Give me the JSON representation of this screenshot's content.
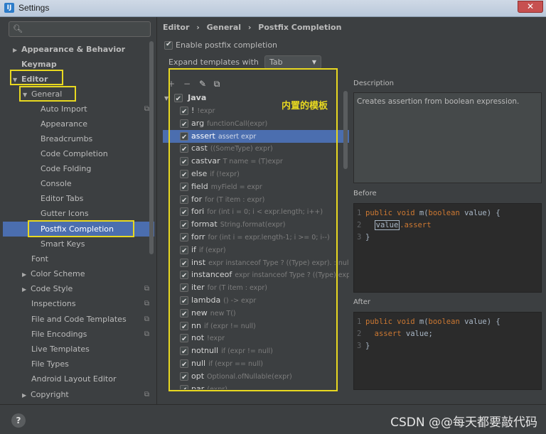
{
  "window": {
    "title": "Settings",
    "close": "✕"
  },
  "search": {
    "placeholder": "Q‣"
  },
  "sidebar": {
    "items": [
      {
        "label": "Appearance & Behavior"
      },
      {
        "label": "Keymap"
      },
      {
        "label": "Editor"
      },
      {
        "label": "General"
      },
      {
        "label": "Auto Import"
      },
      {
        "label": "Appearance"
      },
      {
        "label": "Breadcrumbs"
      },
      {
        "label": "Code Completion"
      },
      {
        "label": "Code Folding"
      },
      {
        "label": "Console"
      },
      {
        "label": "Editor Tabs"
      },
      {
        "label": "Gutter Icons"
      },
      {
        "label": "Postfix Completion"
      },
      {
        "label": "Smart Keys"
      },
      {
        "label": "Font"
      },
      {
        "label": "Color Scheme"
      },
      {
        "label": "Code Style"
      },
      {
        "label": "Inspections"
      },
      {
        "label": "File and Code Templates"
      },
      {
        "label": "File Encodings"
      },
      {
        "label": "Live Templates"
      },
      {
        "label": "File Types"
      },
      {
        "label": "Android Layout Editor"
      },
      {
        "label": "Copyright"
      }
    ]
  },
  "breadcrumb": {
    "a": "Editor",
    "sep": "›",
    "b": "General",
    "c": "Postfix Completion"
  },
  "options": {
    "enable_label": "Enable postfix completion",
    "expand_label": "Expand templates with",
    "expand_value": "Tab"
  },
  "annotation": "内置的模板",
  "templates": {
    "group": "Java",
    "rows": [
      {
        "key": "!",
        "expr": "!expr"
      },
      {
        "key": "arg",
        "expr": "functionCall(expr)"
      },
      {
        "key": "assert",
        "expr": "assert expr"
      },
      {
        "key": "cast",
        "expr": "((SomeType) expr)"
      },
      {
        "key": "castvar",
        "expr": "T name = (T)expr"
      },
      {
        "key": "else",
        "expr": "if (!expr)"
      },
      {
        "key": "field",
        "expr": "myField = expr"
      },
      {
        "key": "for",
        "expr": "for (T item : expr)"
      },
      {
        "key": "fori",
        "expr": "for (int i = 0; i < expr.length; i++)"
      },
      {
        "key": "format",
        "expr": "String.format(expr)"
      },
      {
        "key": "forr",
        "expr": "for (int i = expr.length-1; i >= 0; i--)"
      },
      {
        "key": "if",
        "expr": "if (expr)"
      },
      {
        "key": "inst",
        "expr": "expr instanceof Type ? ((Type) expr). : null"
      },
      {
        "key": "instanceof",
        "expr": "expr instanceof Type ? ((Type) expr)"
      },
      {
        "key": "iter",
        "expr": "for (T item : expr)"
      },
      {
        "key": "lambda",
        "expr": "() -> expr"
      },
      {
        "key": "new",
        "expr": "new T()"
      },
      {
        "key": "nn",
        "expr": "if (expr != null)"
      },
      {
        "key": "not",
        "expr": "!expr"
      },
      {
        "key": "notnull",
        "expr": "if (expr != null)"
      },
      {
        "key": "null",
        "expr": "if (expr == null)"
      },
      {
        "key": "opt",
        "expr": "Optional.ofNullable(expr)"
      },
      {
        "key": "par",
        "expr": "(expr)"
      }
    ]
  },
  "description": {
    "label": "Description",
    "text": "Creates assertion from boolean expression."
  },
  "before": {
    "label": "Before",
    "l1_kw": "public void",
    "l1_rest": " m(",
    "l1_kw2": "boolean",
    "l1_end": " value) {",
    "l2_var": "value",
    "l2_rest": ".assert",
    "l3": "}"
  },
  "after": {
    "label": "After",
    "l1_kw": "public void",
    "l1_rest": " m(",
    "l1_kw2": "boolean",
    "l1_end": " value) {",
    "l2_kw": "assert",
    "l2_rest": " value;",
    "l3": "}"
  },
  "footer": {
    "help": "?",
    "watermark": "CSDN @@每天都要敲代码"
  }
}
